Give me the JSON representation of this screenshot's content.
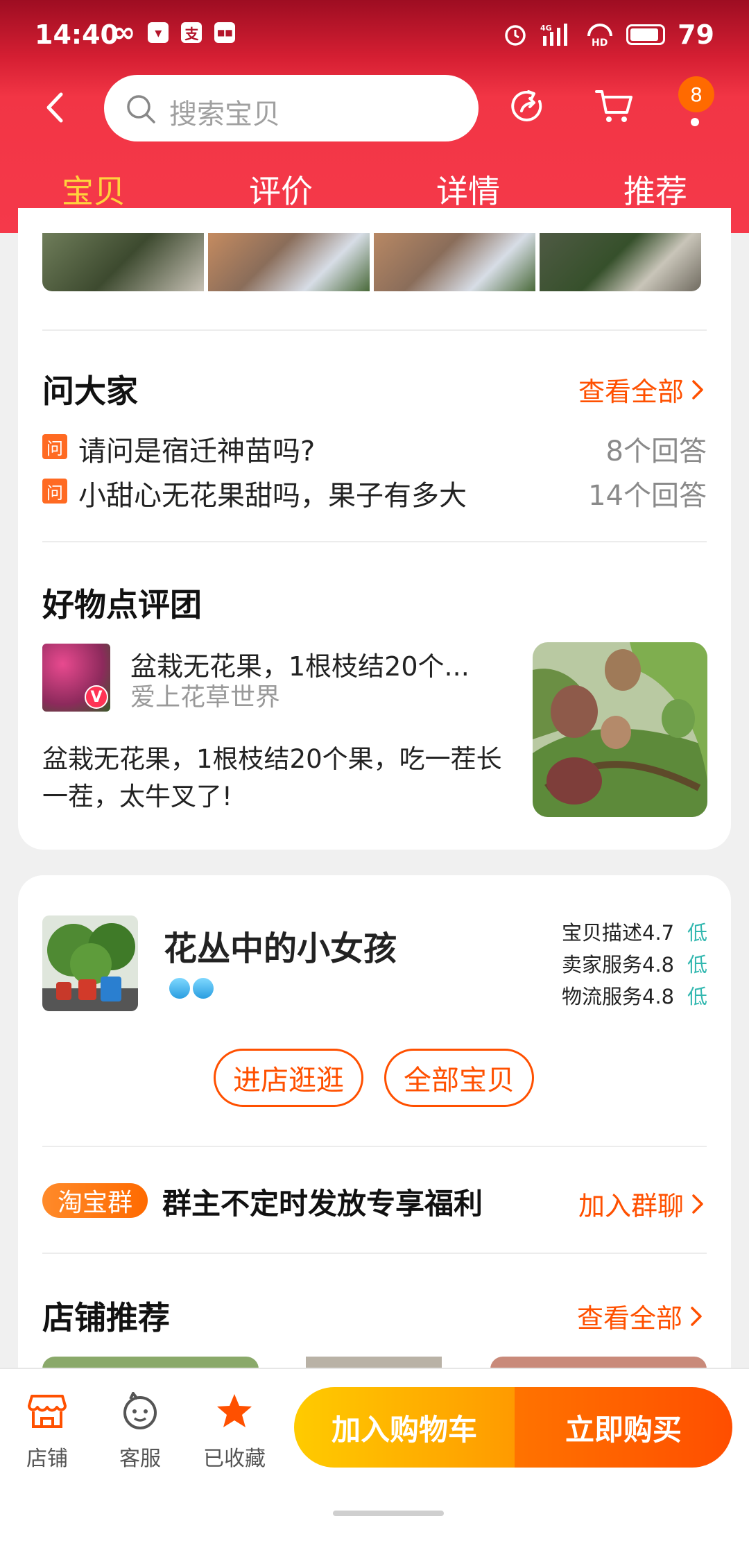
{
  "status_bar": {
    "time": "14:40",
    "left_icons": [
      "infinity-icon",
      "taobao-icon",
      "alipay-icon",
      "app-icon"
    ],
    "right_icons": [
      "alarm-icon",
      "signal-4g-icon",
      "hd-call-icon",
      "battery-icon"
    ],
    "battery": "79"
  },
  "header": {
    "search_placeholder": "搜索宝贝",
    "cart_badge": "8",
    "tabs": [
      {
        "label": "宝贝",
        "active": true
      },
      {
        "label": "评价",
        "active": false
      },
      {
        "label": "详情",
        "active": false
      },
      {
        "label": "推荐",
        "active": false
      }
    ]
  },
  "ask_section": {
    "title": "问大家",
    "see_all": "查看全部",
    "tag": "问",
    "questions": [
      {
        "text": "请问是宿迁神苗吗?",
        "answers": "8个回答"
      },
      {
        "text": "小甜心无花果甜吗，果子有多大",
        "answers": "14个回答"
      }
    ]
  },
  "review_section": {
    "title": "好物点评团",
    "post_title": "盆栽无花果，1根枝结20个...",
    "author": "爱上花草世界",
    "verified_mark": "V",
    "body": "盆栽无花果，1根枝结20个果，吃一茬长一茬，太牛叉了!"
  },
  "shop": {
    "name": "花丛中的小女孩",
    "ratings": [
      {
        "label": "宝贝描述",
        "score": "4.7",
        "level": "低"
      },
      {
        "label": "卖家服务",
        "score": "4.8",
        "level": "低"
      },
      {
        "label": "物流服务",
        "score": "4.8",
        "level": "低"
      }
    ],
    "enter_shop": "进店逛逛",
    "all_items": "全部宝贝",
    "level_color": "#33b8b0"
  },
  "group": {
    "tag": "淘宝群",
    "text": "群主不定时发放专享福利",
    "join": "加入群聊"
  },
  "shop_recommend": {
    "title": "店铺推荐",
    "see_all": "查看全部"
  },
  "bottom_bar": {
    "store": "店铺",
    "service": "客服",
    "favorited": "已收藏",
    "add_to_cart": "加入购物车",
    "buy_now": "立即购买"
  },
  "colors": {
    "brand_red": "#f5394a",
    "accent_orange": "#ff5000",
    "tab_active": "#ffd23d"
  }
}
